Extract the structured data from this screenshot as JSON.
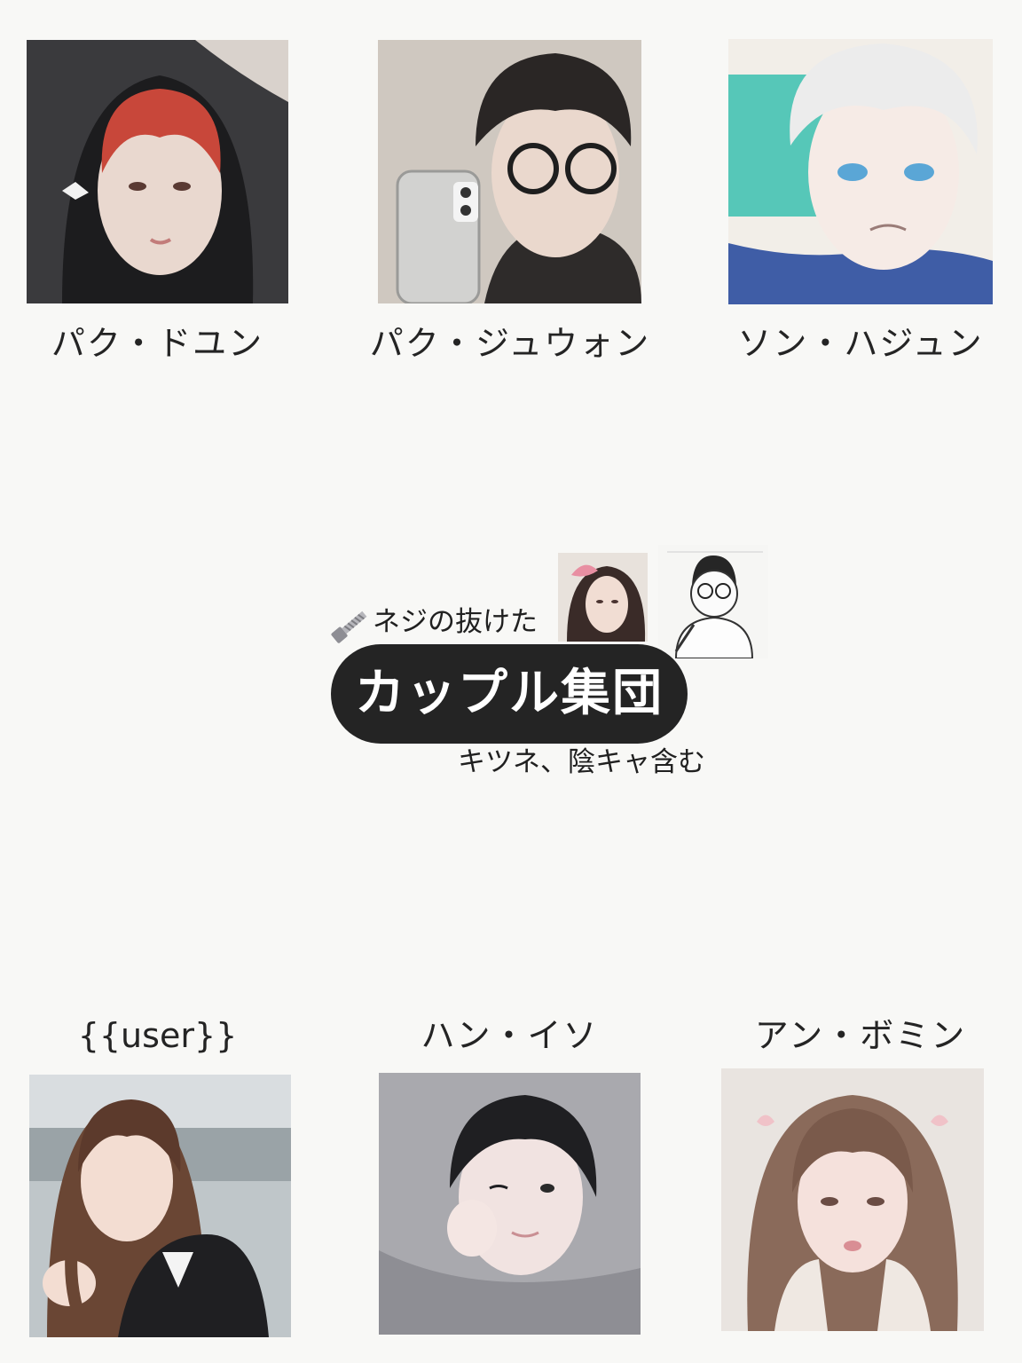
{
  "characters_top": [
    {
      "name": "パク・ドユン"
    },
    {
      "name": "パク・ジュウォン"
    },
    {
      "name": "ソン・ハジュン"
    }
  ],
  "characters_bottom": [
    {
      "name": "{{user}}"
    },
    {
      "name": "ハン・イソ"
    },
    {
      "name": "アン・ボミン"
    }
  ],
  "group": {
    "subtitle_top": "ネジの抜けた",
    "title": "カップル集団",
    "subtitle_bottom": "キツネ、陰キャ含む"
  },
  "colors": {
    "background": "#f8f8f6",
    "pill": "#242424",
    "pill_text": "#ffffff",
    "text": "#242424"
  },
  "icons": {
    "screw": "screw-icon"
  }
}
